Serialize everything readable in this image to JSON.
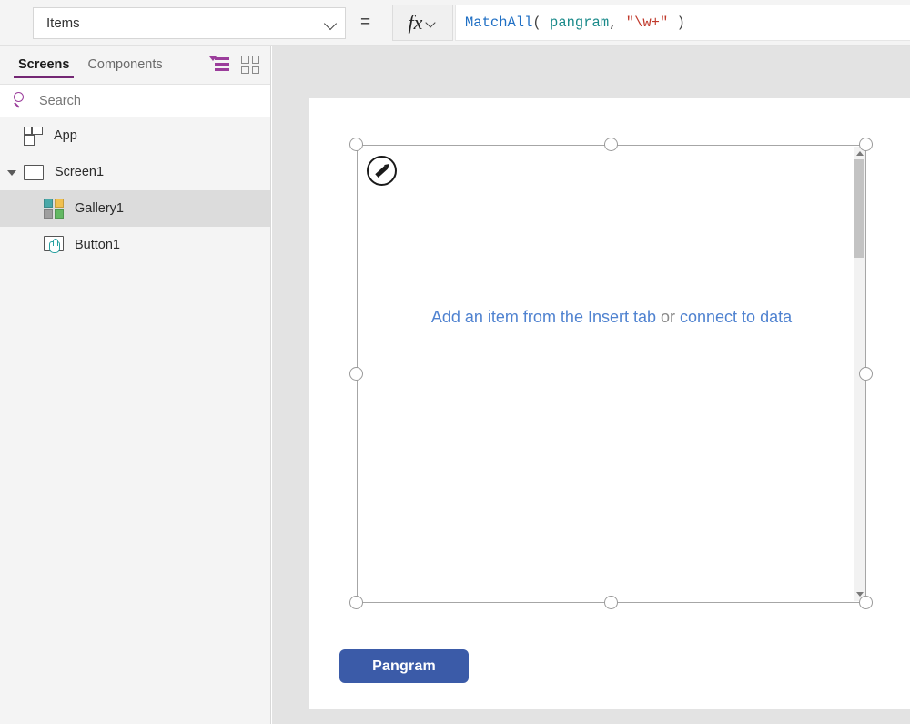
{
  "formula_bar": {
    "property_value": "Items",
    "equals": "=",
    "fx_label": "fx",
    "formula_text": "MatchAll( pangram, \"\\w+\" )",
    "formula_tokens": [
      {
        "text": "MatchAll",
        "type": "fn"
      },
      {
        "text": "( ",
        "type": "paren"
      },
      {
        "text": "pangram",
        "type": "ident"
      },
      {
        "text": ", ",
        "type": "punct"
      },
      {
        "text": "\"\\w+\"",
        "type": "str"
      },
      {
        "text": " )",
        "type": "paren"
      }
    ]
  },
  "left_panel": {
    "tabs": [
      {
        "label": "Screens",
        "active": true
      },
      {
        "label": "Components",
        "active": false
      }
    ],
    "tree_view_icon": "tree-list-icon",
    "grid_view_icon": "grid-view-icon",
    "search": {
      "placeholder": "Search",
      "value": "",
      "icon": "search-icon"
    },
    "tree": [
      {
        "label": "App",
        "icon": "app-icon",
        "level": 0,
        "selected": false,
        "expandable": false
      },
      {
        "label": "Screen1",
        "icon": "screen-icon",
        "level": 0,
        "selected": false,
        "expandable": true,
        "expanded": true
      },
      {
        "label": "Gallery1",
        "icon": "gallery-icon",
        "level": 1,
        "selected": true,
        "expandable": false
      },
      {
        "label": "Button1",
        "icon": "button-icon",
        "level": 1,
        "selected": false,
        "expandable": false
      }
    ]
  },
  "canvas": {
    "gallery": {
      "empty_prefix_link": "Add an item from the Insert tab",
      "empty_middle": "or",
      "empty_suffix_link": "connect to data",
      "edit_badge_icon": "pencil-edit-icon",
      "scrollbar": {
        "up_arrow_icon": "chevron-up-icon",
        "down_arrow_icon": "chevron-down-icon"
      }
    },
    "pangram_button_label": "Pangram"
  },
  "colors": {
    "accent_purple": "#742774",
    "link_blue": "#4f82d0",
    "button_blue": "#3b5ba8",
    "selection_gray": "#dcdcdc",
    "workspace_gray": "#e3e3e3",
    "formula_fn": "#1f6fc4",
    "formula_ident": "#1a8a8a",
    "formula_string": "#c0392b",
    "gallery_icon_teal": "#4aa8a8",
    "gallery_icon_gold": "#f0c050",
    "gallery_icon_gray": "#9e9e9e",
    "gallery_icon_green": "#63b863"
  }
}
